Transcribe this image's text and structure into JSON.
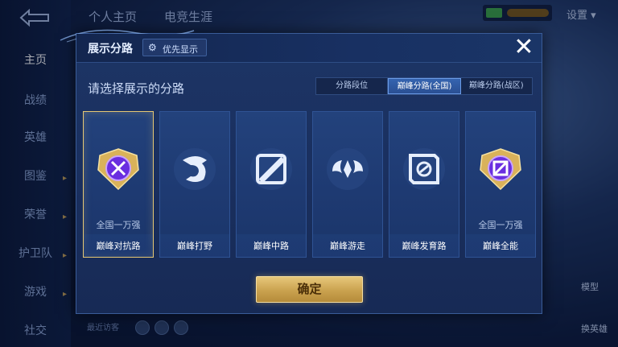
{
  "background": {
    "top_tabs": [
      "个人主页",
      "电竞生涯"
    ],
    "sidebar": [
      {
        "label": "主页",
        "active": true
      },
      {
        "label": "战绩",
        "active": false
      },
      {
        "label": "英雄",
        "active": false
      },
      {
        "label": "图鉴",
        "active": false
      },
      {
        "label": "荣誉",
        "active": false
      },
      {
        "label": "护卫队",
        "active": false
      },
      {
        "label": "游戏",
        "active": false
      },
      {
        "label": "社交",
        "active": false
      }
    ],
    "settings_label": "设置 ▾",
    "right_labels": [
      "模型",
      "换英雄"
    ],
    "recent_visitors": "最近访客"
  },
  "dialog": {
    "title": "展示分路",
    "priority_button": "优先显示",
    "subtitle": "请选择展示的分路",
    "close": "✕",
    "tabs": [
      {
        "label": "分路段位",
        "active": false
      },
      {
        "label": "巅峰分路(全国)",
        "active": true
      },
      {
        "label": "巅峰分路(战区)",
        "active": false
      }
    ],
    "cards": [
      {
        "name": "巅峰对抗路",
        "rank": "全国一万强",
        "icon": "clash-lane-badge-icon",
        "selected": true
      },
      {
        "name": "巅峰打野",
        "rank": "",
        "icon": "jungle-dragon-icon",
        "selected": false
      },
      {
        "name": "巅峰中路",
        "rank": "",
        "icon": "mid-lane-icon",
        "selected": false
      },
      {
        "name": "巅峰游走",
        "rank": "",
        "icon": "roam-wings-icon",
        "selected": false
      },
      {
        "name": "巅峰发育路",
        "rank": "",
        "icon": "farm-lane-icon",
        "selected": false
      },
      {
        "name": "巅峰全能",
        "rank": "全国一万强",
        "icon": "all-round-badge-icon",
        "selected": false
      }
    ],
    "confirm": "确定"
  },
  "colors": {
    "accent_gold": "#e6c873",
    "active_tab": "#3564b0",
    "badge_purple": "#7a3df0"
  }
}
